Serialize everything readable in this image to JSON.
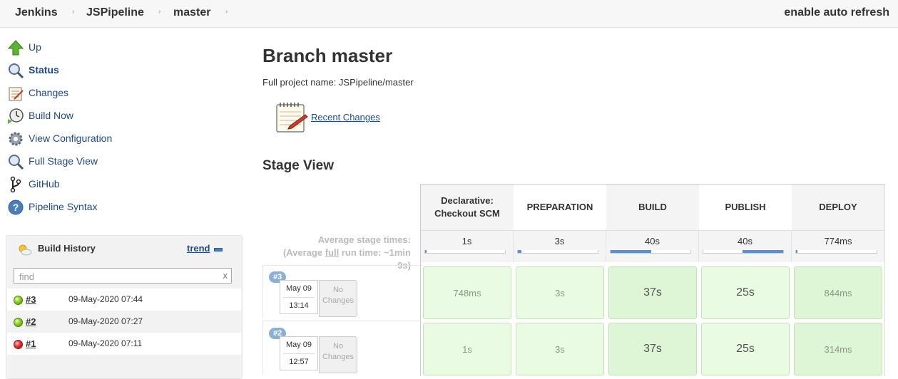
{
  "breadcrumb": {
    "items": [
      "Jenkins",
      "JSPipeline",
      "master"
    ],
    "separator": "›",
    "auto_refresh": "enable auto refresh"
  },
  "sidebar": {
    "items": [
      {
        "label": "Up",
        "icon": "up-arrow-icon"
      },
      {
        "label": "Status",
        "icon": "magnifier-icon",
        "active": true
      },
      {
        "label": "Changes",
        "icon": "notepad-icon"
      },
      {
        "label": "Build Now",
        "icon": "clock-icon"
      },
      {
        "label": "View Configuration",
        "icon": "gear-icon"
      },
      {
        "label": "Full Stage View",
        "icon": "magnifier-icon"
      },
      {
        "label": "GitHub",
        "icon": "git-branch-icon"
      },
      {
        "label": "Pipeline Syntax",
        "icon": "help-icon"
      }
    ]
  },
  "build_history": {
    "title": "Build History",
    "trend": "trend",
    "find_placeholder": "find",
    "clear": "x",
    "builds": [
      {
        "number": "#3",
        "date": "09-May-2020 07:44",
        "status": "success"
      },
      {
        "number": "#2",
        "date": "09-May-2020 07:27",
        "status": "success"
      },
      {
        "number": "#1",
        "date": "09-May-2020 07:11",
        "status": "failed"
      }
    ]
  },
  "main": {
    "title": "Branch master",
    "full_name": "Full project name: JSPipeline/master",
    "recent_changes": "Recent Changes",
    "stage_view_title": "Stage View"
  },
  "stage_view": {
    "avg_label_1": "Average stage times:",
    "avg_label_2a": "(Average ",
    "avg_label_2b": "full",
    "avg_label_2c": " run time: ~1min",
    "avg_label_3": "9s)",
    "stages": [
      {
        "name_1": "Declarative:",
        "name_2": "Checkout SCM",
        "avg": "1s",
        "avg_fraction": 0.01
      },
      {
        "name_1": "PREPARATION",
        "name_2": "",
        "avg": "3s",
        "avg_fraction": 0.04
      },
      {
        "name_1": "BUILD",
        "name_2": "",
        "avg": "40s",
        "avg_fraction": 0.5
      },
      {
        "name_1": "PUBLISH",
        "name_2": "",
        "avg": "40s",
        "avg_fraction": 0.5
      },
      {
        "name_1": "DEPLOY",
        "name_2": "",
        "avg": "774ms",
        "avg_fraction": 0.01
      }
    ],
    "runs": [
      {
        "badge": "#3",
        "date": "May 09",
        "time": "13:14",
        "changes_1": "No",
        "changes_2": "Changes",
        "cells": [
          "748ms",
          "3s",
          "37s",
          "25s",
          "844ms"
        ]
      },
      {
        "badge": "#2",
        "date": "May 09",
        "time": "12:57",
        "changes_1": "No",
        "changes_2": "Changes",
        "cells": [
          "1s",
          "3s",
          "37s",
          "25s",
          "314ms"
        ]
      }
    ]
  }
}
